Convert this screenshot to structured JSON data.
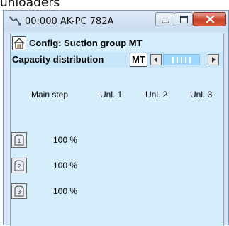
{
  "caption": "unloaders",
  "window": {
    "title": "00:000 AK-PC 782A",
    "controls": [
      "minimize-icon",
      "maximize-icon",
      "close-icon"
    ]
  },
  "config": {
    "label": "Config: Suction group MT"
  },
  "capacity": {
    "label": "Capacity distribution",
    "group_button": "MT",
    "pager_icons": [
      "chevron-left-icon",
      "chevron-right-icon"
    ]
  },
  "columns": [
    "Main step",
    "Unl. 1",
    "Unl. 2",
    "Unl. 3"
  ],
  "steps": [
    {
      "icon_number": "1",
      "main_step": "100 %"
    },
    {
      "icon_number": "2",
      "main_step": "100 %"
    },
    {
      "icon_number": "3",
      "main_step": "100 %"
    }
  ]
}
